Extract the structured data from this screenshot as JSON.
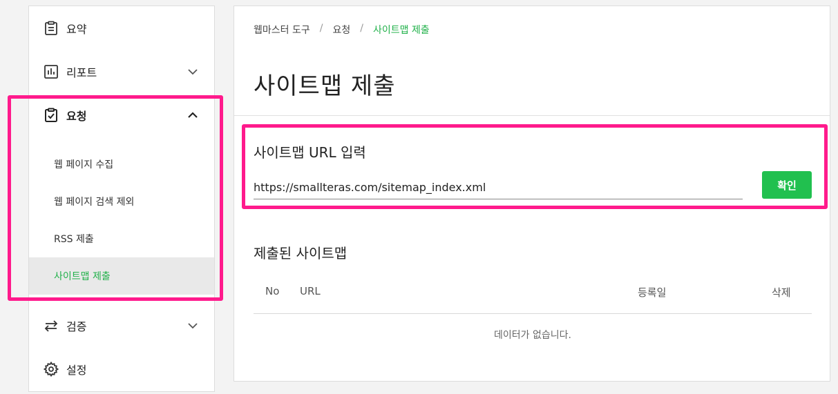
{
  "sidebar": {
    "items": [
      {
        "label": "요약",
        "icon": "clipboard-icon"
      },
      {
        "label": "리포트",
        "icon": "bar-chart-icon"
      },
      {
        "label": "요청",
        "icon": "clipboard-check-icon"
      },
      {
        "label": "검증",
        "icon": "swap-arrows-icon"
      },
      {
        "label": "설정",
        "icon": "gear-icon"
      }
    ],
    "request_sub_items": [
      {
        "label": "웹 페이지 수집"
      },
      {
        "label": "웹 페이지 검색 제외"
      },
      {
        "label": "RSS 제출"
      },
      {
        "label": "사이트맵 제출"
      }
    ],
    "active_sub_item": "사이트맵 제출"
  },
  "breadcrumb": [
    "웹마스터 도구",
    "요청",
    "사이트맵 제출"
  ],
  "page_title": "사이트맵 제출",
  "sitemap_form": {
    "label": "사이트맵 URL 입력",
    "value": "https://smallteras.com/sitemap_index.xml",
    "button_label": "확인"
  },
  "submitted": {
    "title": "제출된 사이트맵",
    "columns": [
      "No",
      "URL",
      "등록일",
      "삭제"
    ],
    "rows": [],
    "empty_message": "데이터가 없습니다."
  },
  "colors": {
    "accent": "#21b14a",
    "button": "#21c04f",
    "highlight": "#ff1a8c"
  }
}
